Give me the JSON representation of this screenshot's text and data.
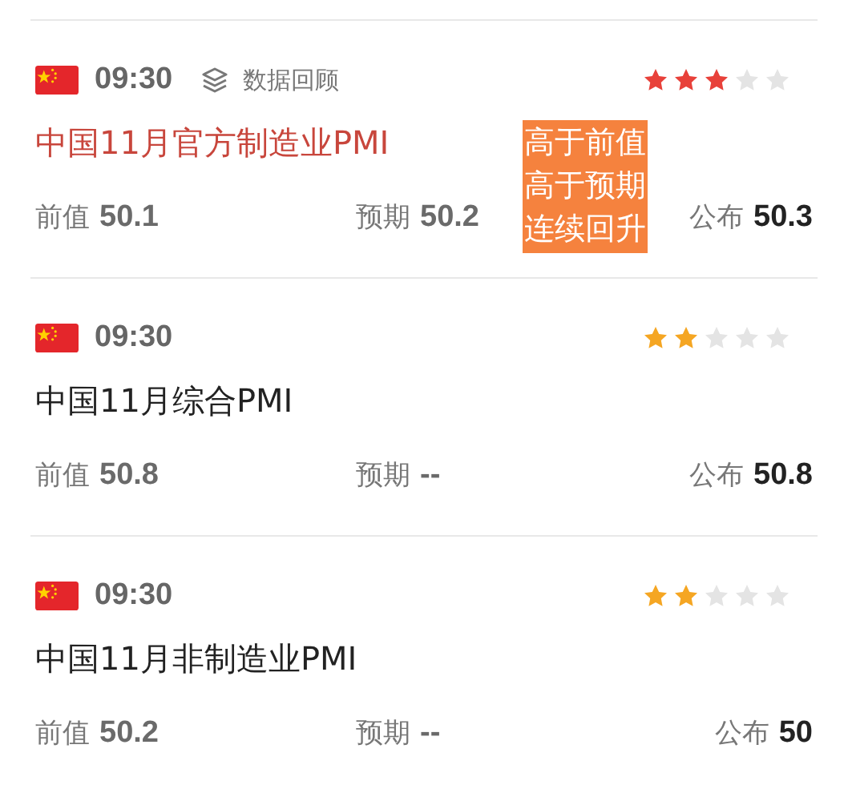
{
  "events": [
    {
      "time": "09:30",
      "review": "数据回顾",
      "stars": 3,
      "color": "#e8413a",
      "highlight": true,
      "title": "中国11月官方制造业PMI",
      "tags": [
        "高于前值",
        "高于预期",
        "连续回升"
      ],
      "fields": [
        {
          "kind": "previous",
          "label": "前值",
          "value": "50.1"
        },
        {
          "kind": "forecast",
          "label": "预期",
          "value": "50.2"
        },
        {
          "kind": "actual",
          "label": "公布",
          "value": "50.3"
        }
      ]
    },
    {
      "time": "09:30",
      "stars": 2,
      "color": "#f5a623",
      "highlight": false,
      "title": "中国11月综合PMI",
      "fields": [
        {
          "kind": "previous",
          "label": "前值",
          "value": "50.8"
        },
        {
          "kind": "forecast",
          "label": "预期",
          "value": "--"
        },
        {
          "kind": "actual",
          "label": "公布",
          "value": "50.8"
        }
      ]
    },
    {
      "time": "09:30",
      "stars": 2,
      "color": "#f5a623",
      "highlight": false,
      "title": "中国11月非制造业PMI",
      "fields": [
        {
          "kind": "previous",
          "label": "前值",
          "value": "50.2"
        },
        {
          "kind": "forecast",
          "label": "预期",
          "value": "--"
        },
        {
          "kind": "actual",
          "label": "公布",
          "value": "50"
        }
      ]
    }
  ]
}
